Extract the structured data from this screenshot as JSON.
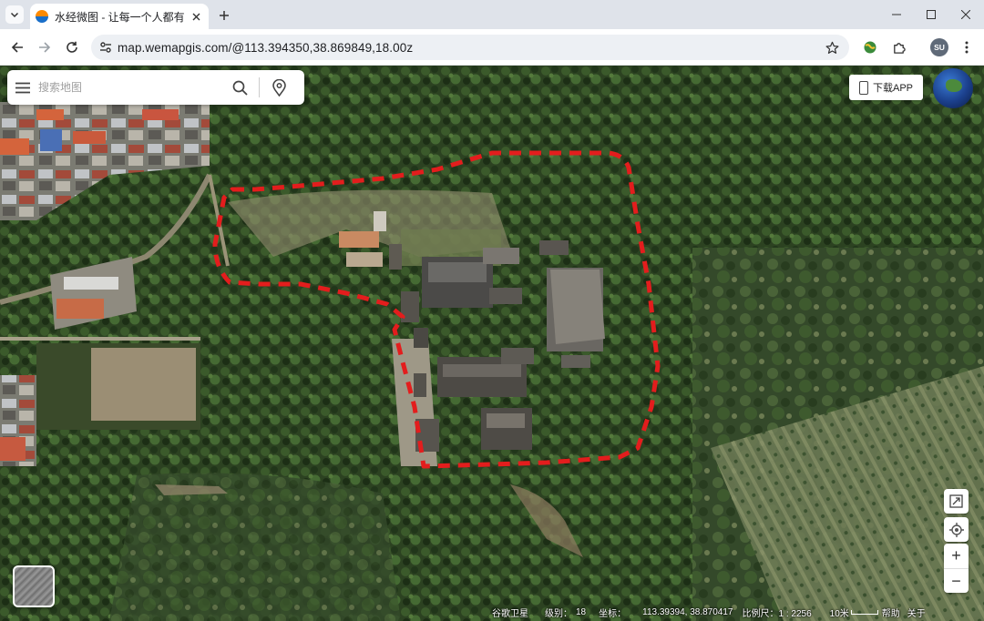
{
  "browser": {
    "tab_title": "水经微图 - 让每一个人都有自己",
    "url": "map.wemapgis.com/@113.394350,38.869849,18.00z",
    "profile_initials": "SU",
    "icons": [
      "tab-search-icon",
      "close-icon",
      "plus-icon",
      "minimize-icon",
      "maximize-icon",
      "window-close-icon",
      "back-arrow-icon",
      "forward-arrow-icon",
      "reload-icon",
      "site-info-icon",
      "star-icon",
      "extension-globe-icon",
      "puzzle-icon",
      "kebab-menu-icon"
    ]
  },
  "map": {
    "search_placeholder": "搜索地图",
    "download_label": "下载APP",
    "controls": {
      "zoom_in": "+",
      "zoom_out": "−"
    },
    "status": {
      "layer_name": "谷歌卫星",
      "level_label": "级别：",
      "level_value": "18",
      "coord_label": "坐标：",
      "coord_value": "113.39394, 38.870417",
      "scale_label": "比例尺：1 : 2256",
      "scale_bar": "10米",
      "help": "帮助",
      "about": "关于"
    },
    "colors": {
      "boundary": "#e31d1d",
      "vegetation": "#2f4a24"
    }
  }
}
